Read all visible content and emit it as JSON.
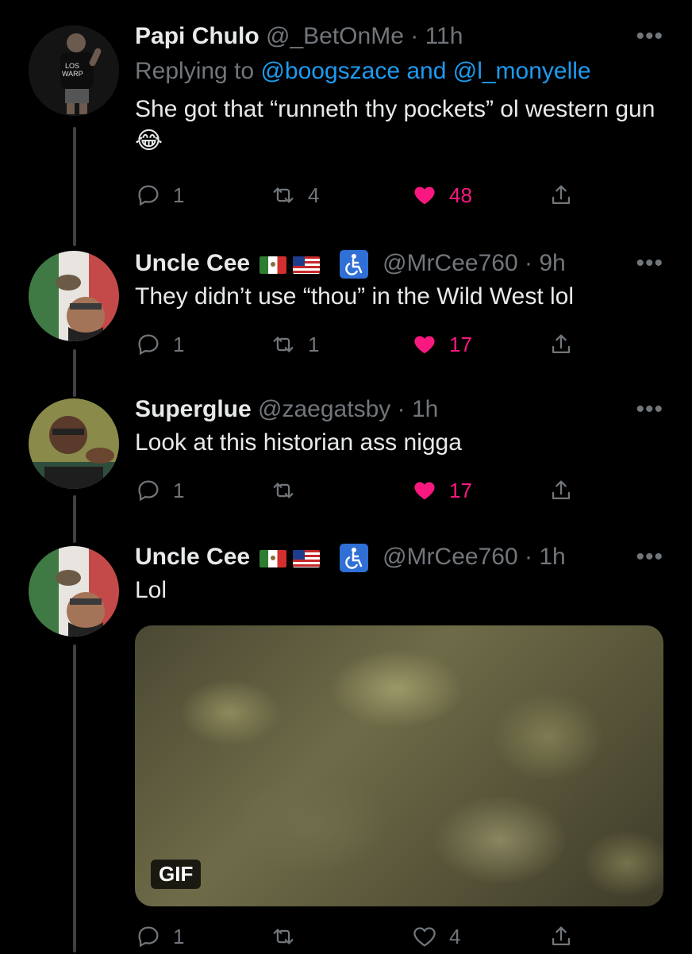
{
  "tweets": [
    {
      "name": "Papi Chulo",
      "handle": "@_BetOnMe",
      "dot": "·",
      "time": "11h",
      "more": "•••",
      "reply_prefix": "Replying to",
      "reply_mention_1": "@boogszace",
      "reply_and": "and",
      "reply_mention_2": "@l_monyelle",
      "text": "She got that “runneth thy pockets” ol western gun 😂",
      "replies": "1",
      "retweets": "4",
      "likes": "48"
    },
    {
      "name": "Uncle Cee",
      "handle": "@MrCee760",
      "dot": "·",
      "time": "9h",
      "more": "•••",
      "text": "They didn’t use “thou” in the Wild West lol",
      "replies": "1",
      "retweets": "1",
      "likes": "17"
    },
    {
      "name": "Superglue",
      "handle": "@zaegatsby",
      "dot": "·",
      "time": "1h",
      "more": "•••",
      "text": "Look at this historian ass nigga",
      "replies": "1",
      "retweets": "",
      "likes": "17"
    },
    {
      "name": "Uncle Cee",
      "handle": "@MrCee760",
      "dot": "·",
      "time": "1h",
      "more": "•••",
      "text": "Lol",
      "media_badge": "GIF",
      "replies": "1",
      "retweets": "",
      "likes": "4"
    }
  ],
  "colors": {
    "like_active": "#f91880",
    "mention": "#1d9bf0",
    "muted": "#71767b",
    "background": "#000000"
  }
}
